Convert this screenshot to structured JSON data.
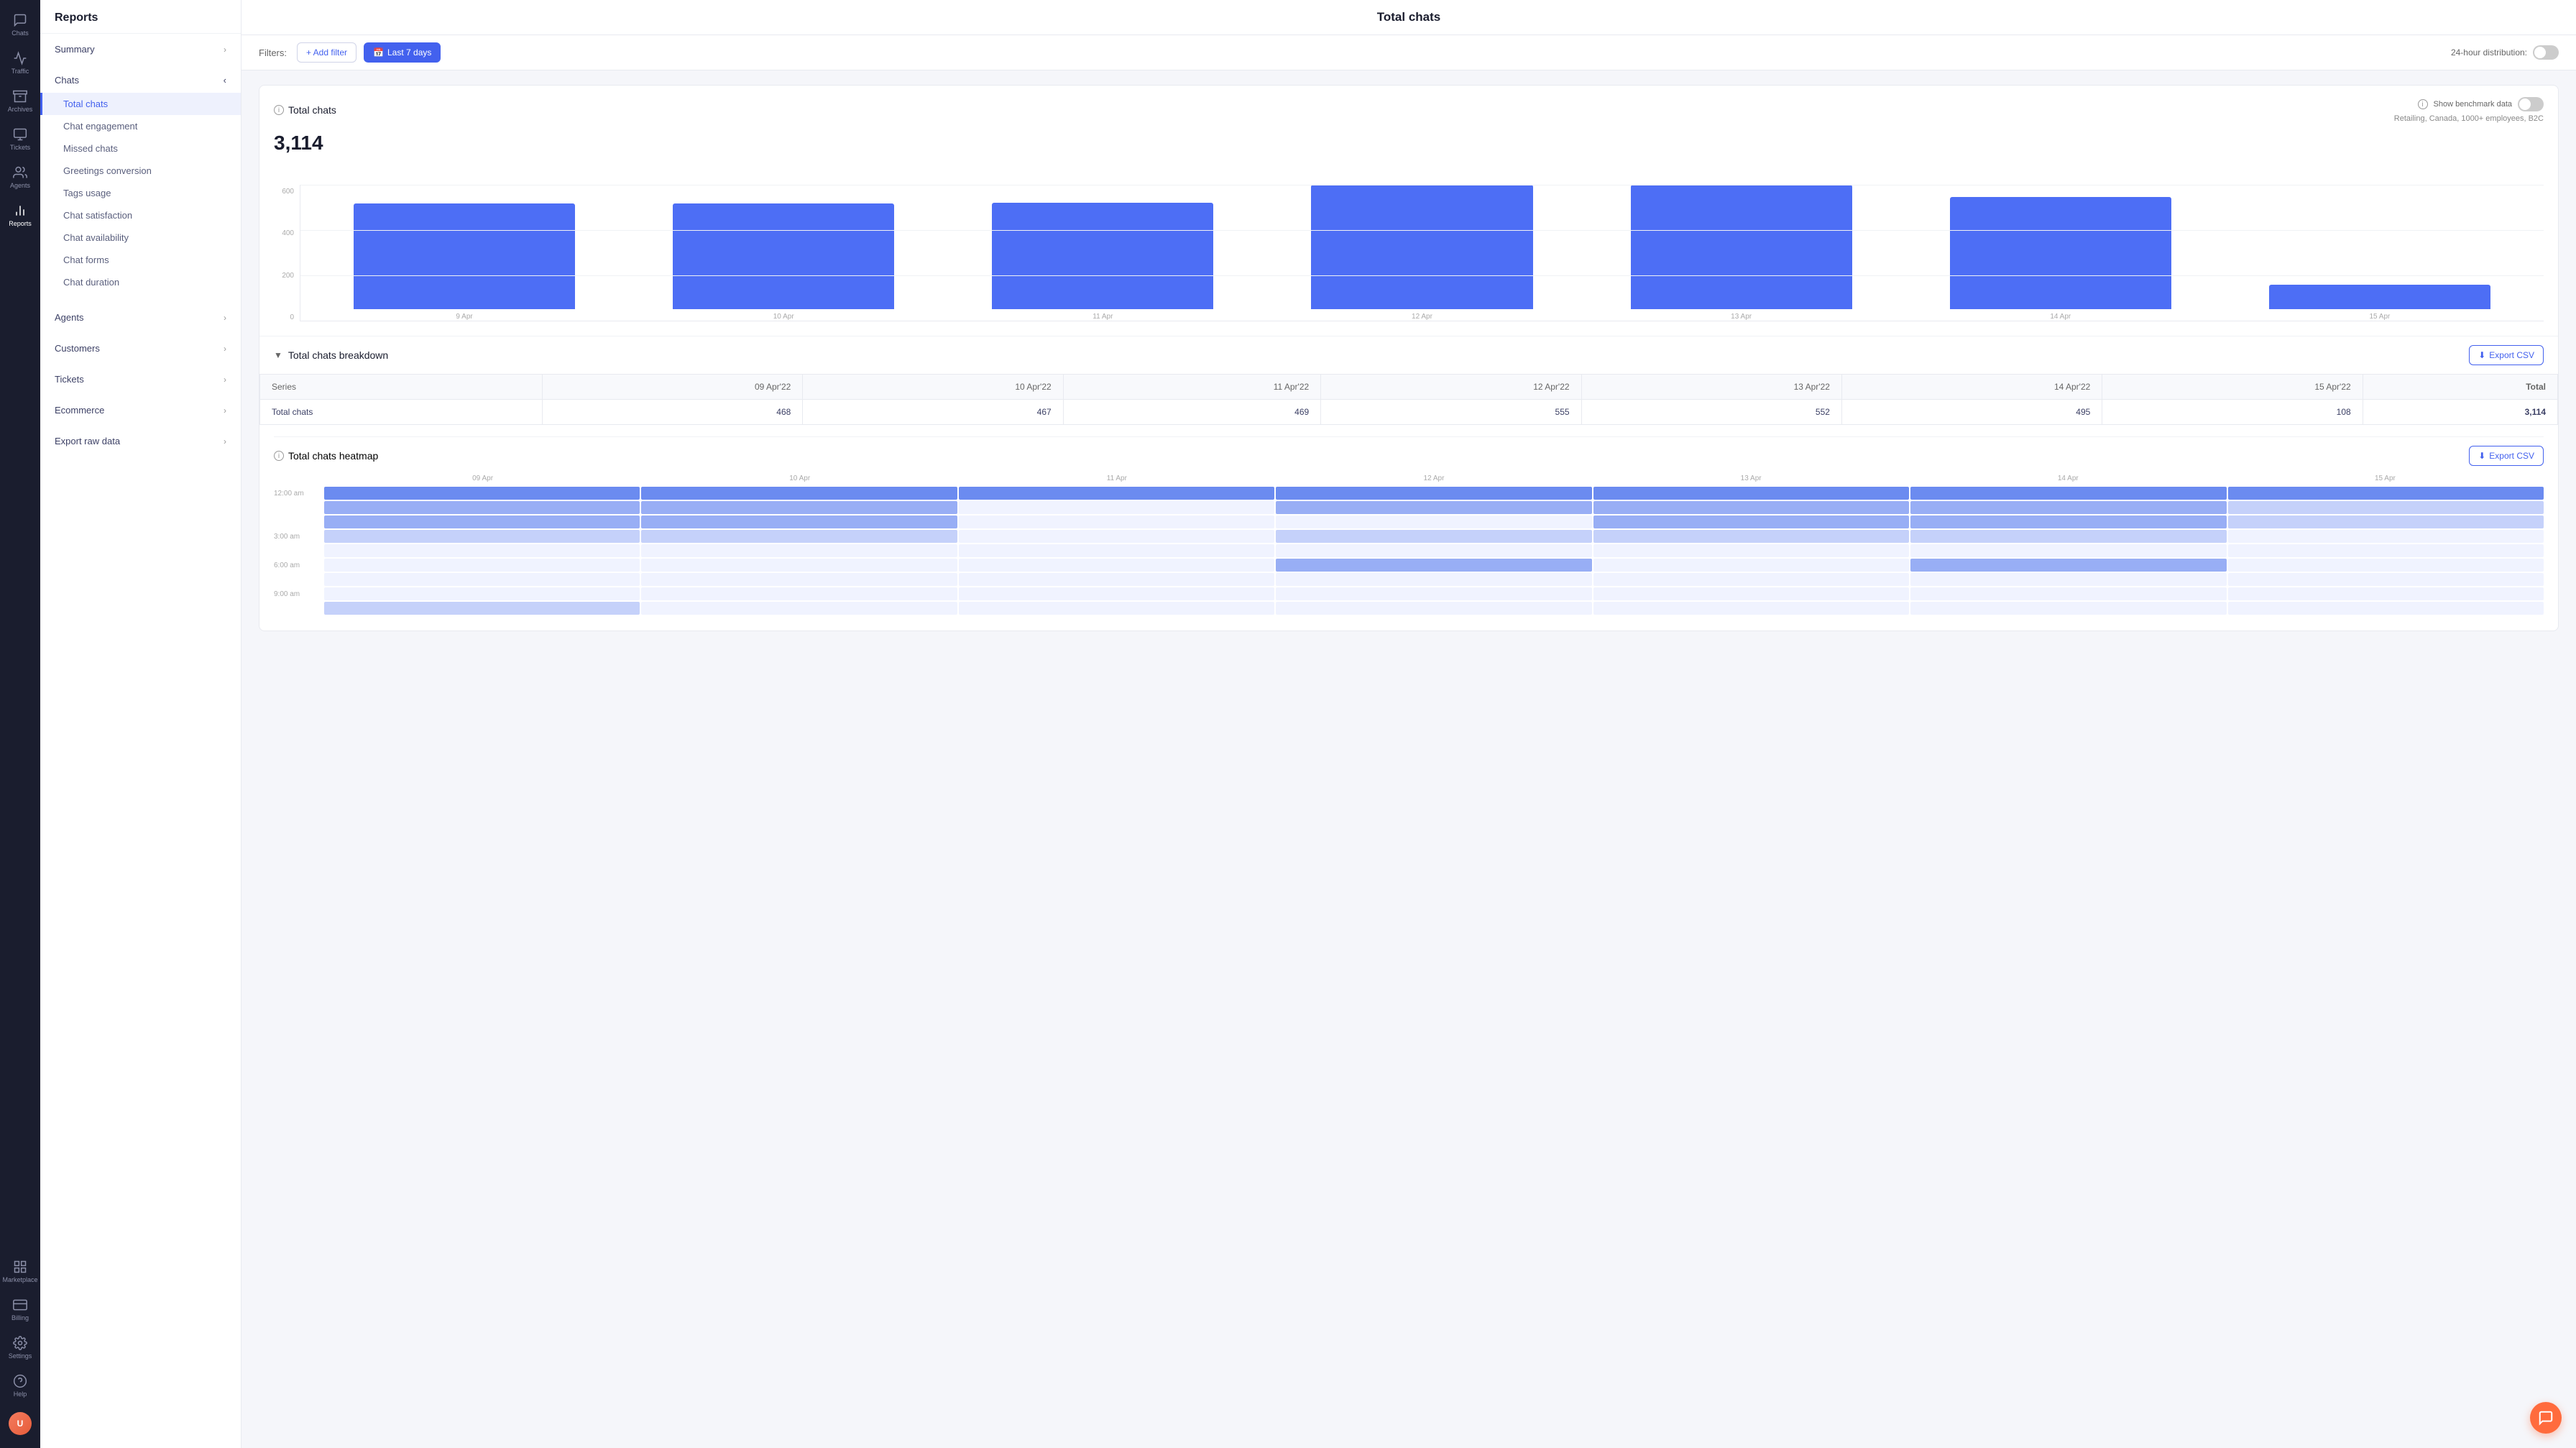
{
  "app": {
    "title": "Reports"
  },
  "icon_nav": {
    "items": [
      {
        "id": "chats",
        "label": "Chats",
        "active": false
      },
      {
        "id": "traffic",
        "label": "Traffic",
        "active": false
      },
      {
        "id": "archives",
        "label": "Archives",
        "active": false
      },
      {
        "id": "tickets",
        "label": "Tickets",
        "active": false
      },
      {
        "id": "agents",
        "label": "Agents",
        "active": false
      },
      {
        "id": "reports",
        "label": "Reports",
        "active": true
      }
    ],
    "bottom_items": [
      {
        "id": "marketplace",
        "label": "Marketplace"
      },
      {
        "id": "billing",
        "label": "Billing"
      },
      {
        "id": "settings",
        "label": "Settings"
      },
      {
        "id": "help",
        "label": "Help"
      }
    ]
  },
  "left_nav": {
    "title": "Reports",
    "sections": [
      {
        "id": "summary",
        "label": "Summary",
        "expandable": true,
        "expanded": false
      },
      {
        "id": "chats",
        "label": "Chats",
        "expandable": true,
        "expanded": true,
        "sub_items": [
          {
            "id": "total-chats",
            "label": "Total chats",
            "active": true
          },
          {
            "id": "chat-engagement",
            "label": "Chat engagement",
            "active": false
          },
          {
            "id": "missed-chats",
            "label": "Missed chats",
            "active": false
          },
          {
            "id": "greetings-conversion",
            "label": "Greetings conversion",
            "active": false
          },
          {
            "id": "tags-usage",
            "label": "Tags usage",
            "active": false
          },
          {
            "id": "chat-satisfaction",
            "label": "Chat satisfaction",
            "active": false
          },
          {
            "id": "chat-availability",
            "label": "Chat availability",
            "active": false
          },
          {
            "id": "chat-forms",
            "label": "Chat forms",
            "active": false
          },
          {
            "id": "chat-duration",
            "label": "Chat duration",
            "active": false
          }
        ]
      },
      {
        "id": "agents",
        "label": "Agents",
        "expandable": true,
        "expanded": false
      },
      {
        "id": "customers",
        "label": "Customers",
        "expandable": true,
        "expanded": false
      },
      {
        "id": "tickets",
        "label": "Tickets",
        "expandable": true,
        "expanded": false
      },
      {
        "id": "ecommerce",
        "label": "Ecommerce",
        "expandable": true,
        "expanded": false
      },
      {
        "id": "export-raw-data",
        "label": "Export raw data",
        "expandable": true,
        "expanded": false
      }
    ]
  },
  "page": {
    "title": "Total chats",
    "filters_label": "Filters:",
    "add_filter_btn": "+ Add filter",
    "date_filter_btn": "Last 7 days",
    "distribution_label": "24-hour distribution:",
    "benchmark_label": "Show benchmark data",
    "benchmark_info": "Retailing, Canada, 1000+ employees, B2C"
  },
  "total_chats_section": {
    "title": "Total chats",
    "value": "3,114",
    "bar_chart": {
      "y_axis": [
        "0",
        "200",
        "400",
        "600"
      ],
      "bars": [
        {
          "label": "9 Apr",
          "value": 468,
          "height_pct": 78
        },
        {
          "label": "10 Apr",
          "value": 467,
          "height_pct": 77.8
        },
        {
          "label": "11 Apr",
          "value": 469,
          "height_pct": 78.2
        },
        {
          "label": "12 Apr",
          "value": 555,
          "height_pct": 92.5
        },
        {
          "label": "13 Apr",
          "value": 552,
          "height_pct": 92
        },
        {
          "label": "14 Apr",
          "value": 495,
          "height_pct": 82.5
        },
        {
          "label": "15 Apr",
          "value": 108,
          "height_pct": 18
        }
      ]
    }
  },
  "breakdown_section": {
    "title": "Total chats breakdown",
    "export_label": "Export CSV",
    "table": {
      "headers": [
        "Series",
        "09 Apr'22",
        "10 Apr'22",
        "11 Apr'22",
        "12 Apr'22",
        "13 Apr'22",
        "14 Apr'22",
        "15 Apr'22",
        "Total"
      ],
      "rows": [
        {
          "series": "Total chats",
          "values": [
            "468",
            "467",
            "469",
            "555",
            "552",
            "495",
            "108",
            "3,114"
          ]
        }
      ]
    }
  },
  "heatmap_section": {
    "title": "Total chats heatmap",
    "export_label": "Export CSV",
    "col_headers": [
      "09 Apr",
      "10 Apr",
      "11 Apr",
      "12 Apr",
      "13 Apr",
      "14 Apr",
      "15 Apr"
    ],
    "rows": [
      {
        "label": "12:00 am",
        "cells": [
          [
            3,
            3,
            3,
            3,
            3,
            3,
            3
          ],
          [
            2,
            2,
            0,
            2,
            2,
            2,
            1
          ],
          [
            2,
            2,
            0,
            0,
            2,
            2,
            1
          ]
        ]
      },
      {
        "label": "3:00 am",
        "cells": [
          [
            1,
            1,
            0,
            1,
            1,
            1,
            0
          ],
          [
            0,
            0,
            0,
            0,
            0,
            0,
            0
          ]
        ]
      },
      {
        "label": "6:00 am",
        "cells": [
          [
            0,
            0,
            0,
            1,
            0,
            2,
            0
          ],
          [
            0,
            0,
            0,
            0,
            0,
            0,
            0
          ]
        ]
      },
      {
        "label": "9:00 am",
        "cells": [
          [
            0,
            0,
            0,
            0,
            0,
            0,
            0
          ],
          [
            1,
            0,
            0,
            0,
            0,
            0,
            0
          ]
        ]
      }
    ]
  }
}
